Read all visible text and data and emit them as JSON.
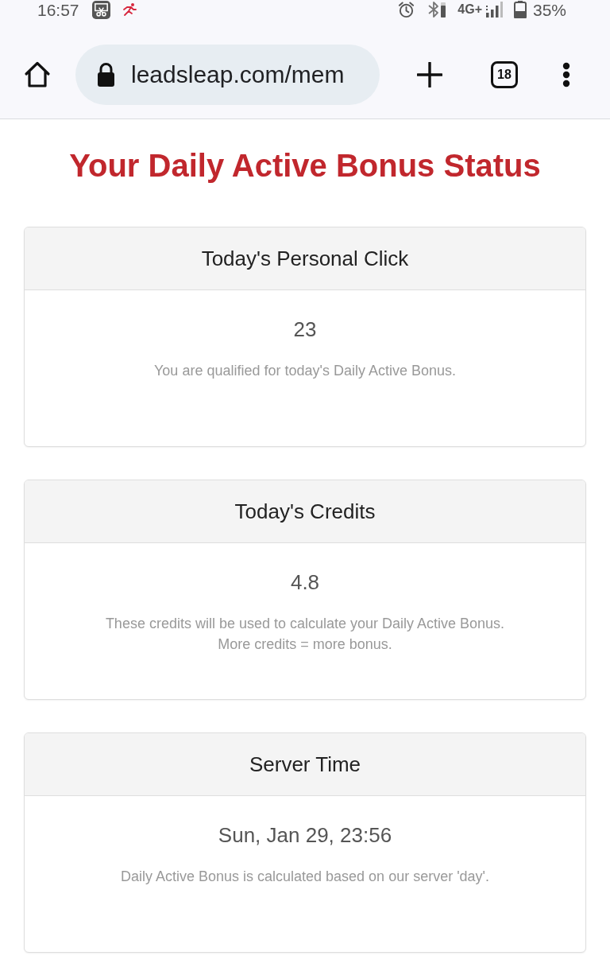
{
  "status_bar": {
    "time": "16:57",
    "network": "4G+",
    "battery": "35%"
  },
  "browser": {
    "url": "leadsleap.com/mem",
    "tab_count": "18"
  },
  "title": "Your Daily Active Bonus Status",
  "cards": [
    {
      "header": "Today's Personal Click",
      "value": "23",
      "notes": [
        "You are qualified for today's Daily Active Bonus."
      ]
    },
    {
      "header": "Today's Credits",
      "value": "4.8",
      "notes": [
        "These credits will be used to calculate your Daily Active Bonus.",
        "More credits = more bonus."
      ]
    },
    {
      "header": "Server Time",
      "value": "Sun, Jan 29, 23:56",
      "notes": [
        "Daily Active Bonus is calculated based on our server 'day'."
      ]
    }
  ]
}
